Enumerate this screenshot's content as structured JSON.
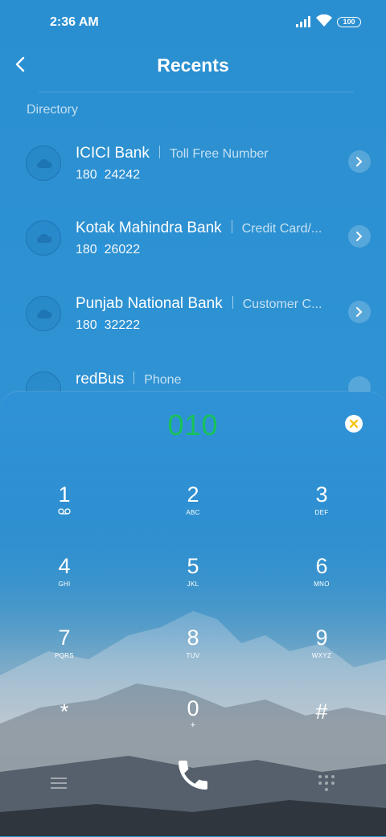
{
  "status_bar": {
    "time": "2:36 AM",
    "battery": "100"
  },
  "header": {
    "title": "Recents"
  },
  "directory": {
    "section_label": "Directory",
    "items": [
      {
        "name": "ICICI Bank",
        "label": "Toll Free Number",
        "num_a": "180",
        "num_hl": "0",
        "num_b": "24242"
      },
      {
        "name": "Kotak Mahindra Bank",
        "label": "Credit Card/...",
        "num_a": "180",
        "num_hl": "0",
        "num_b": "26022"
      },
      {
        "name": "Punjab National Bank",
        "label": "Customer C...",
        "num_a": "180",
        "num_hl": "0",
        "num_b": "32222"
      },
      {
        "name": "redBus",
        "label": "Phone"
      }
    ]
  },
  "dialer": {
    "input": "010",
    "keys": [
      {
        "digit": "1",
        "letters": ""
      },
      {
        "digit": "2",
        "letters": "ABC"
      },
      {
        "digit": "3",
        "letters": "DEF"
      },
      {
        "digit": "4",
        "letters": "GHI"
      },
      {
        "digit": "5",
        "letters": "JKL"
      },
      {
        "digit": "6",
        "letters": "MNO"
      },
      {
        "digit": "7",
        "letters": "PQRS"
      },
      {
        "digit": "8",
        "letters": "TUV"
      },
      {
        "digit": "9",
        "letters": "WXYZ"
      },
      {
        "digit": "*",
        "letters": ""
      },
      {
        "digit": "0",
        "letters": "+"
      },
      {
        "digit": "#",
        "letters": ""
      }
    ]
  },
  "colors": {
    "accent_digits": "#18c25a",
    "number_highlight": "#1f9cf0",
    "clear_icon": "#f5c518"
  }
}
